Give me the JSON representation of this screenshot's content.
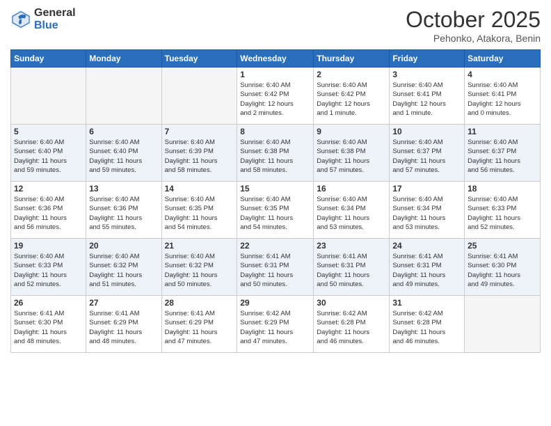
{
  "logo": {
    "general": "General",
    "blue": "Blue"
  },
  "header": {
    "month": "October 2025",
    "location": "Pehonko, Atakora, Benin"
  },
  "days_of_week": [
    "Sunday",
    "Monday",
    "Tuesday",
    "Wednesday",
    "Thursday",
    "Friday",
    "Saturday"
  ],
  "weeks": [
    [
      {
        "day": "",
        "info": ""
      },
      {
        "day": "",
        "info": ""
      },
      {
        "day": "",
        "info": ""
      },
      {
        "day": "1",
        "info": "Sunrise: 6:40 AM\nSunset: 6:42 PM\nDaylight: 12 hours\nand 2 minutes."
      },
      {
        "day": "2",
        "info": "Sunrise: 6:40 AM\nSunset: 6:42 PM\nDaylight: 12 hours\nand 1 minute."
      },
      {
        "day": "3",
        "info": "Sunrise: 6:40 AM\nSunset: 6:41 PM\nDaylight: 12 hours\nand 1 minute."
      },
      {
        "day": "4",
        "info": "Sunrise: 6:40 AM\nSunset: 6:41 PM\nDaylight: 12 hours\nand 0 minutes."
      }
    ],
    [
      {
        "day": "5",
        "info": "Sunrise: 6:40 AM\nSunset: 6:40 PM\nDaylight: 11 hours\nand 59 minutes."
      },
      {
        "day": "6",
        "info": "Sunrise: 6:40 AM\nSunset: 6:40 PM\nDaylight: 11 hours\nand 59 minutes."
      },
      {
        "day": "7",
        "info": "Sunrise: 6:40 AM\nSunset: 6:39 PM\nDaylight: 11 hours\nand 58 minutes."
      },
      {
        "day": "8",
        "info": "Sunrise: 6:40 AM\nSunset: 6:38 PM\nDaylight: 11 hours\nand 58 minutes."
      },
      {
        "day": "9",
        "info": "Sunrise: 6:40 AM\nSunset: 6:38 PM\nDaylight: 11 hours\nand 57 minutes."
      },
      {
        "day": "10",
        "info": "Sunrise: 6:40 AM\nSunset: 6:37 PM\nDaylight: 11 hours\nand 57 minutes."
      },
      {
        "day": "11",
        "info": "Sunrise: 6:40 AM\nSunset: 6:37 PM\nDaylight: 11 hours\nand 56 minutes."
      }
    ],
    [
      {
        "day": "12",
        "info": "Sunrise: 6:40 AM\nSunset: 6:36 PM\nDaylight: 11 hours\nand 56 minutes."
      },
      {
        "day": "13",
        "info": "Sunrise: 6:40 AM\nSunset: 6:36 PM\nDaylight: 11 hours\nand 55 minutes."
      },
      {
        "day": "14",
        "info": "Sunrise: 6:40 AM\nSunset: 6:35 PM\nDaylight: 11 hours\nand 54 minutes."
      },
      {
        "day": "15",
        "info": "Sunrise: 6:40 AM\nSunset: 6:35 PM\nDaylight: 11 hours\nand 54 minutes."
      },
      {
        "day": "16",
        "info": "Sunrise: 6:40 AM\nSunset: 6:34 PM\nDaylight: 11 hours\nand 53 minutes."
      },
      {
        "day": "17",
        "info": "Sunrise: 6:40 AM\nSunset: 6:34 PM\nDaylight: 11 hours\nand 53 minutes."
      },
      {
        "day": "18",
        "info": "Sunrise: 6:40 AM\nSunset: 6:33 PM\nDaylight: 11 hours\nand 52 minutes."
      }
    ],
    [
      {
        "day": "19",
        "info": "Sunrise: 6:40 AM\nSunset: 6:33 PM\nDaylight: 11 hours\nand 52 minutes."
      },
      {
        "day": "20",
        "info": "Sunrise: 6:40 AM\nSunset: 6:32 PM\nDaylight: 11 hours\nand 51 minutes."
      },
      {
        "day": "21",
        "info": "Sunrise: 6:40 AM\nSunset: 6:32 PM\nDaylight: 11 hours\nand 50 minutes."
      },
      {
        "day": "22",
        "info": "Sunrise: 6:41 AM\nSunset: 6:31 PM\nDaylight: 11 hours\nand 50 minutes."
      },
      {
        "day": "23",
        "info": "Sunrise: 6:41 AM\nSunset: 6:31 PM\nDaylight: 11 hours\nand 50 minutes."
      },
      {
        "day": "24",
        "info": "Sunrise: 6:41 AM\nSunset: 6:31 PM\nDaylight: 11 hours\nand 49 minutes."
      },
      {
        "day": "25",
        "info": "Sunrise: 6:41 AM\nSunset: 6:30 PM\nDaylight: 11 hours\nand 49 minutes."
      }
    ],
    [
      {
        "day": "26",
        "info": "Sunrise: 6:41 AM\nSunset: 6:30 PM\nDaylight: 11 hours\nand 48 minutes."
      },
      {
        "day": "27",
        "info": "Sunrise: 6:41 AM\nSunset: 6:29 PM\nDaylight: 11 hours\nand 48 minutes."
      },
      {
        "day": "28",
        "info": "Sunrise: 6:41 AM\nSunset: 6:29 PM\nDaylight: 11 hours\nand 47 minutes."
      },
      {
        "day": "29",
        "info": "Sunrise: 6:42 AM\nSunset: 6:29 PM\nDaylight: 11 hours\nand 47 minutes."
      },
      {
        "day": "30",
        "info": "Sunrise: 6:42 AM\nSunset: 6:28 PM\nDaylight: 11 hours\nand 46 minutes."
      },
      {
        "day": "31",
        "info": "Sunrise: 6:42 AM\nSunset: 6:28 PM\nDaylight: 11 hours\nand 46 minutes."
      },
      {
        "day": "",
        "info": ""
      }
    ]
  ]
}
